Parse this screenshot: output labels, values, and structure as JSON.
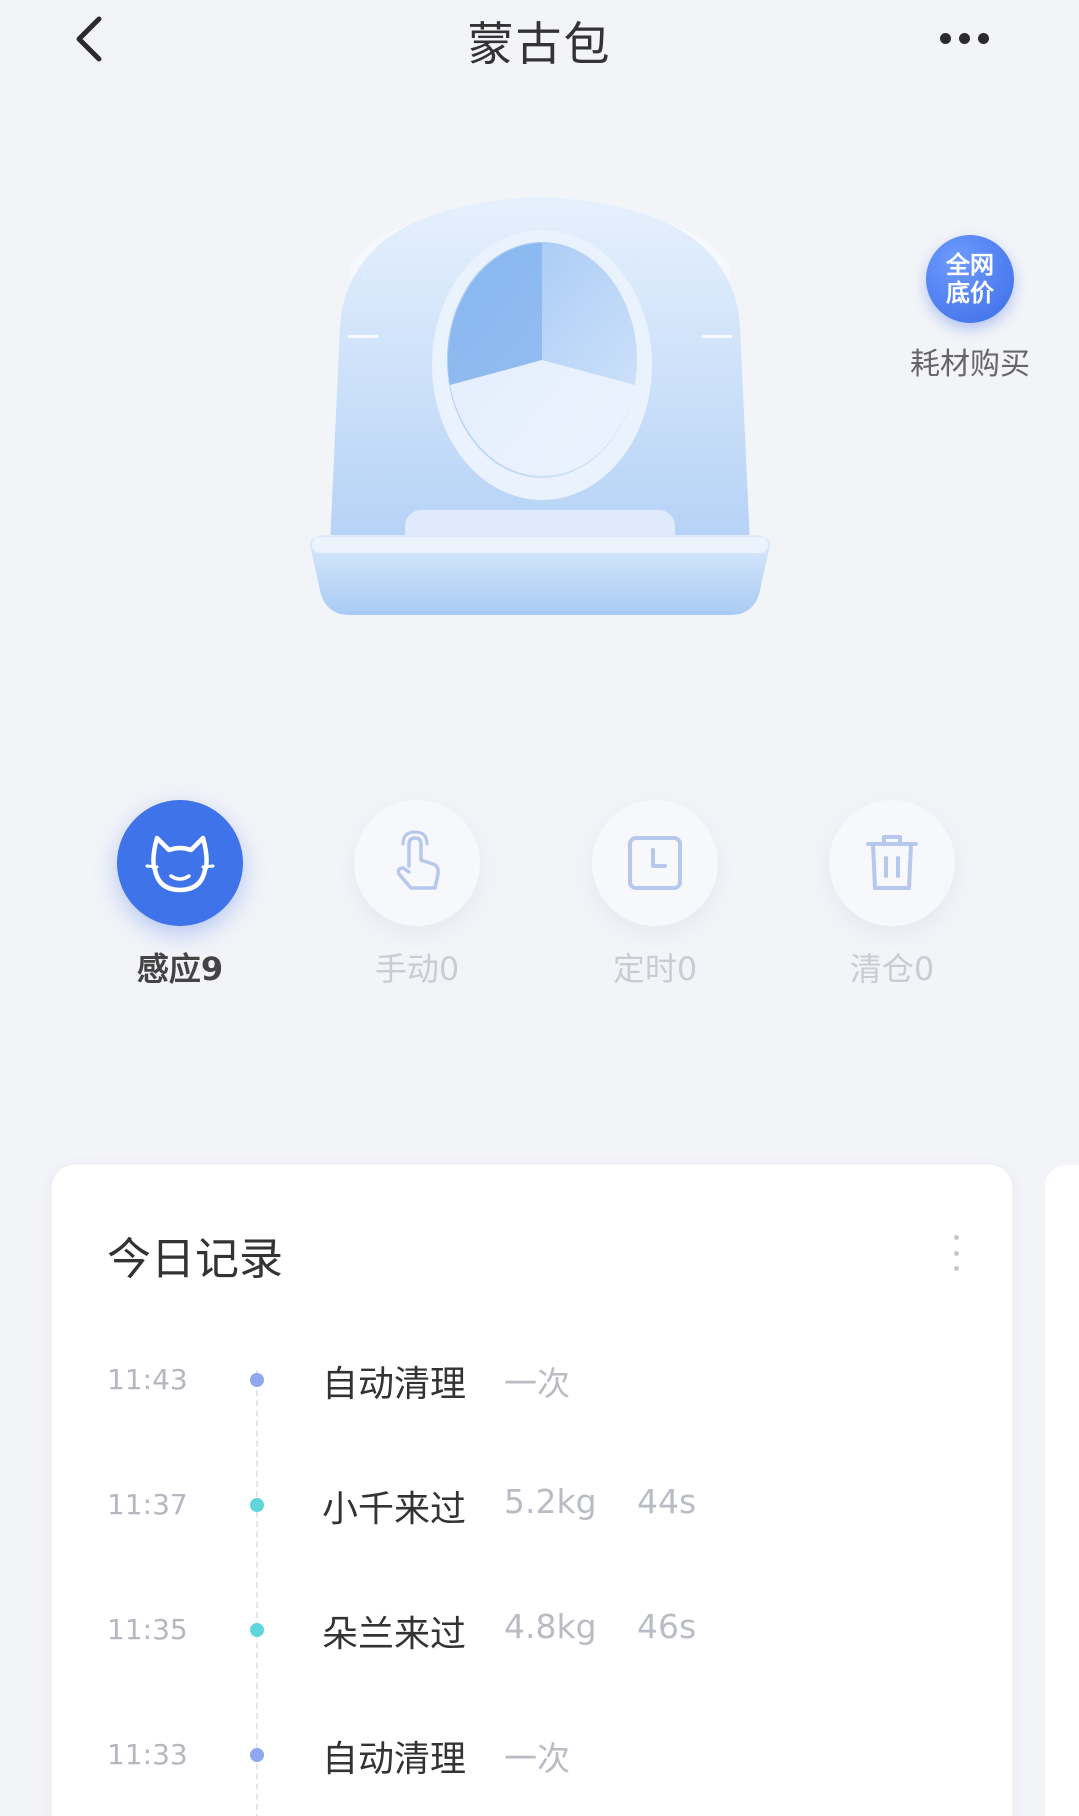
{
  "header": {
    "title": "蒙古包"
  },
  "consumables": {
    "badge_line1": "全网",
    "badge_line2": "底价",
    "label": "耗材购买"
  },
  "modes": [
    {
      "label": "感应",
      "count": "9",
      "active": true
    },
    {
      "label": "手动",
      "count": "0",
      "active": false
    },
    {
      "label": "定时",
      "count": "0",
      "active": false
    },
    {
      "label": "清仓",
      "count": "0",
      "active": false
    }
  ],
  "records": {
    "title": "今日记录",
    "items": [
      {
        "time": "11:43",
        "event": "自动清理",
        "detail": "一次",
        "duration": "",
        "dot_color": "#8fa7ee"
      },
      {
        "time": "11:37",
        "event": "小千来过",
        "detail": "5.2kg",
        "duration": "44s",
        "dot_color": "#5ed6dc"
      },
      {
        "time": "11:35",
        "event": "朵兰来过",
        "detail": "4.8kg",
        "duration": "46s",
        "dot_color": "#5ed6dc"
      },
      {
        "time": "11:33",
        "event": "自动清理",
        "detail": "一次",
        "duration": "",
        "dot_color": "#8fa7ee"
      }
    ]
  },
  "colors": {
    "accent": "#3f73ea",
    "background": "#f3f4f8"
  }
}
